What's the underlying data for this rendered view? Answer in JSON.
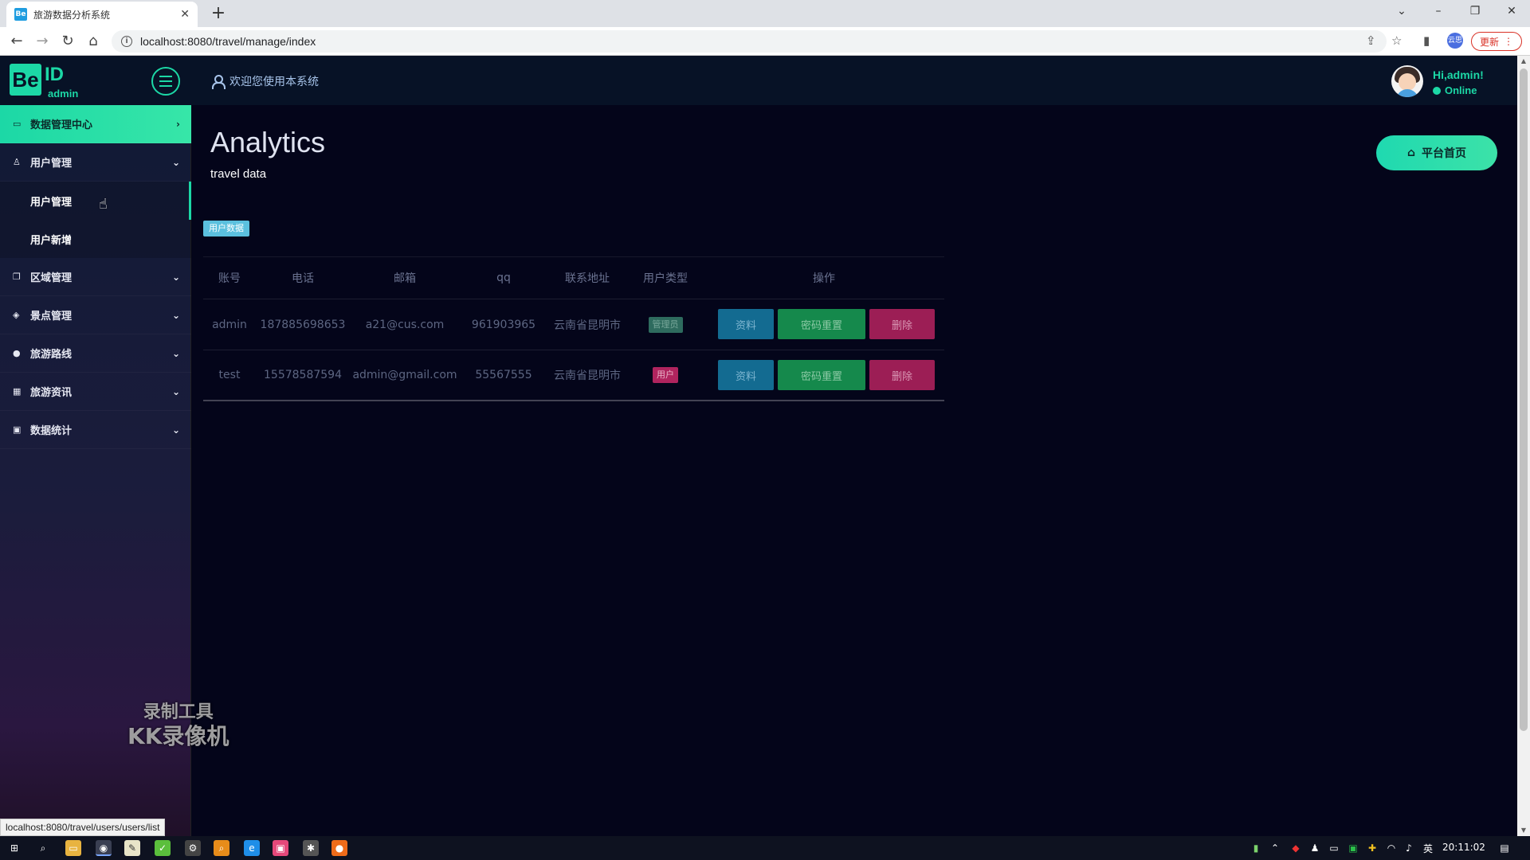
{
  "browser": {
    "tab_title": "旅游数据分析系统",
    "tab_favicon": "Be",
    "url": "localhost:8080/travel/manage/index",
    "update_label": "更新",
    "extension_label": "云思",
    "status_url": "localhost:8080/travel/users/users/list"
  },
  "header": {
    "logo_be": "Be",
    "logo_id": "ID",
    "logo_admin": "admin",
    "welcome": "欢迎您使用本系统",
    "greeting": "Hi,admin!",
    "status": "Online"
  },
  "sidebar": {
    "items": [
      {
        "label": "数据管理中心",
        "icon": "monitor-icon",
        "active": true
      },
      {
        "label": "用户管理",
        "icon": "user-icon"
      },
      {
        "label": "区域管理",
        "icon": "copy-icon"
      },
      {
        "label": "景点管理",
        "icon": "cube-icon"
      },
      {
        "label": "旅游路线",
        "icon": "circle-icon"
      },
      {
        "label": "旅游资讯",
        "icon": "grid-icon"
      },
      {
        "label": "数据统计",
        "icon": "image-icon"
      }
    ],
    "subitems": [
      {
        "label": "用户管理"
      },
      {
        "label": "用户新增"
      }
    ]
  },
  "main": {
    "title": "Analytics",
    "subtitle": "travel data",
    "home_button": "平台首页",
    "badge": "用户数据"
  },
  "table": {
    "columns": [
      "账号",
      "电话",
      "邮箱",
      "qq",
      "联系地址",
      "用户类型",
      "操作"
    ],
    "rows": [
      {
        "account": "admin",
        "phone": "187885698653",
        "email": "a21@cus.com",
        "qq": "961903965",
        "address": "云南省昆明市",
        "type": "管理员"
      },
      {
        "account": "test",
        "phone": "15578587594",
        "email": "admin@gmail.com",
        "qq": "55567555",
        "address": "云南省昆明市",
        "type": "用户"
      }
    ],
    "actions": {
      "info": "资料",
      "reset": "密码重置",
      "delete": "删除"
    }
  },
  "watermark": {
    "line1": "录制工具",
    "line2": "KK录像机"
  },
  "taskbar": {
    "time": "20:11:02",
    "ime": "英"
  },
  "colors": {
    "accent": "#1cd8a6",
    "info": "#136b91",
    "success": "#15894c",
    "danger": "#9c1e55"
  }
}
